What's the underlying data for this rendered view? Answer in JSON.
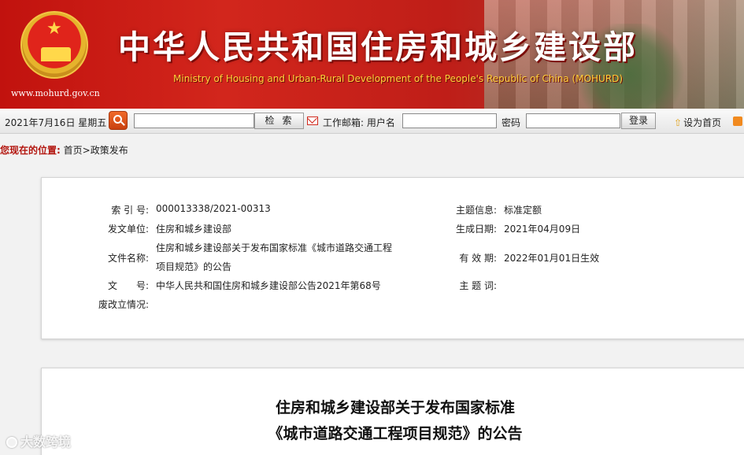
{
  "banner": {
    "site_url": "www.mohurd.gov.cn",
    "title_cn": "中华人民共和国住房和城乡建设部",
    "title_en": "Ministry of Housing and Urban-Rural Development of the People's Republic of China (MOHURD)"
  },
  "toolbar": {
    "date": "2021年7月16日 星期五",
    "search_value": "",
    "search_label": "检索",
    "mail_label": "工作邮箱: 用户名",
    "user_value": "",
    "password_label": "密码",
    "password_value": "",
    "login_label": "登录",
    "home_label": "设为首页"
  },
  "breadcrumb": {
    "label": "您现在的位置:",
    "path": "首页>政策发布"
  },
  "info": {
    "index_label": "索 引 号:",
    "index_value": "000013338/2021-00313",
    "topic_label": "主题信息:",
    "topic_value": "标准定额",
    "issuer_label": "发文单位:",
    "issuer_value": "住房和城乡建设部",
    "date_label": "生成日期:",
    "date_value": "2021年04月09日",
    "filename_label": "文件名称:",
    "filename_line1": "住房和城乡建设部关于发布国家标准《城市道路交通工程",
    "filename_line2": "项目规范》的公告",
    "valid_label": "有 效 期:",
    "valid_value": "2022年01月01日生效",
    "docno_label": "文　　号:",
    "docno_value": "中华人民共和国住房和城乡建设部公告2021年第68号",
    "keyword_label": "主 题 词:",
    "keyword_value": "",
    "status_label": "废改立情况:",
    "status_value": ""
  },
  "article": {
    "title_line1": "住房和城乡建设部关于发布国家标准",
    "title_line2": "《城市道路交通工程项目规范》的公告"
  },
  "watermark": "大数跨境"
}
